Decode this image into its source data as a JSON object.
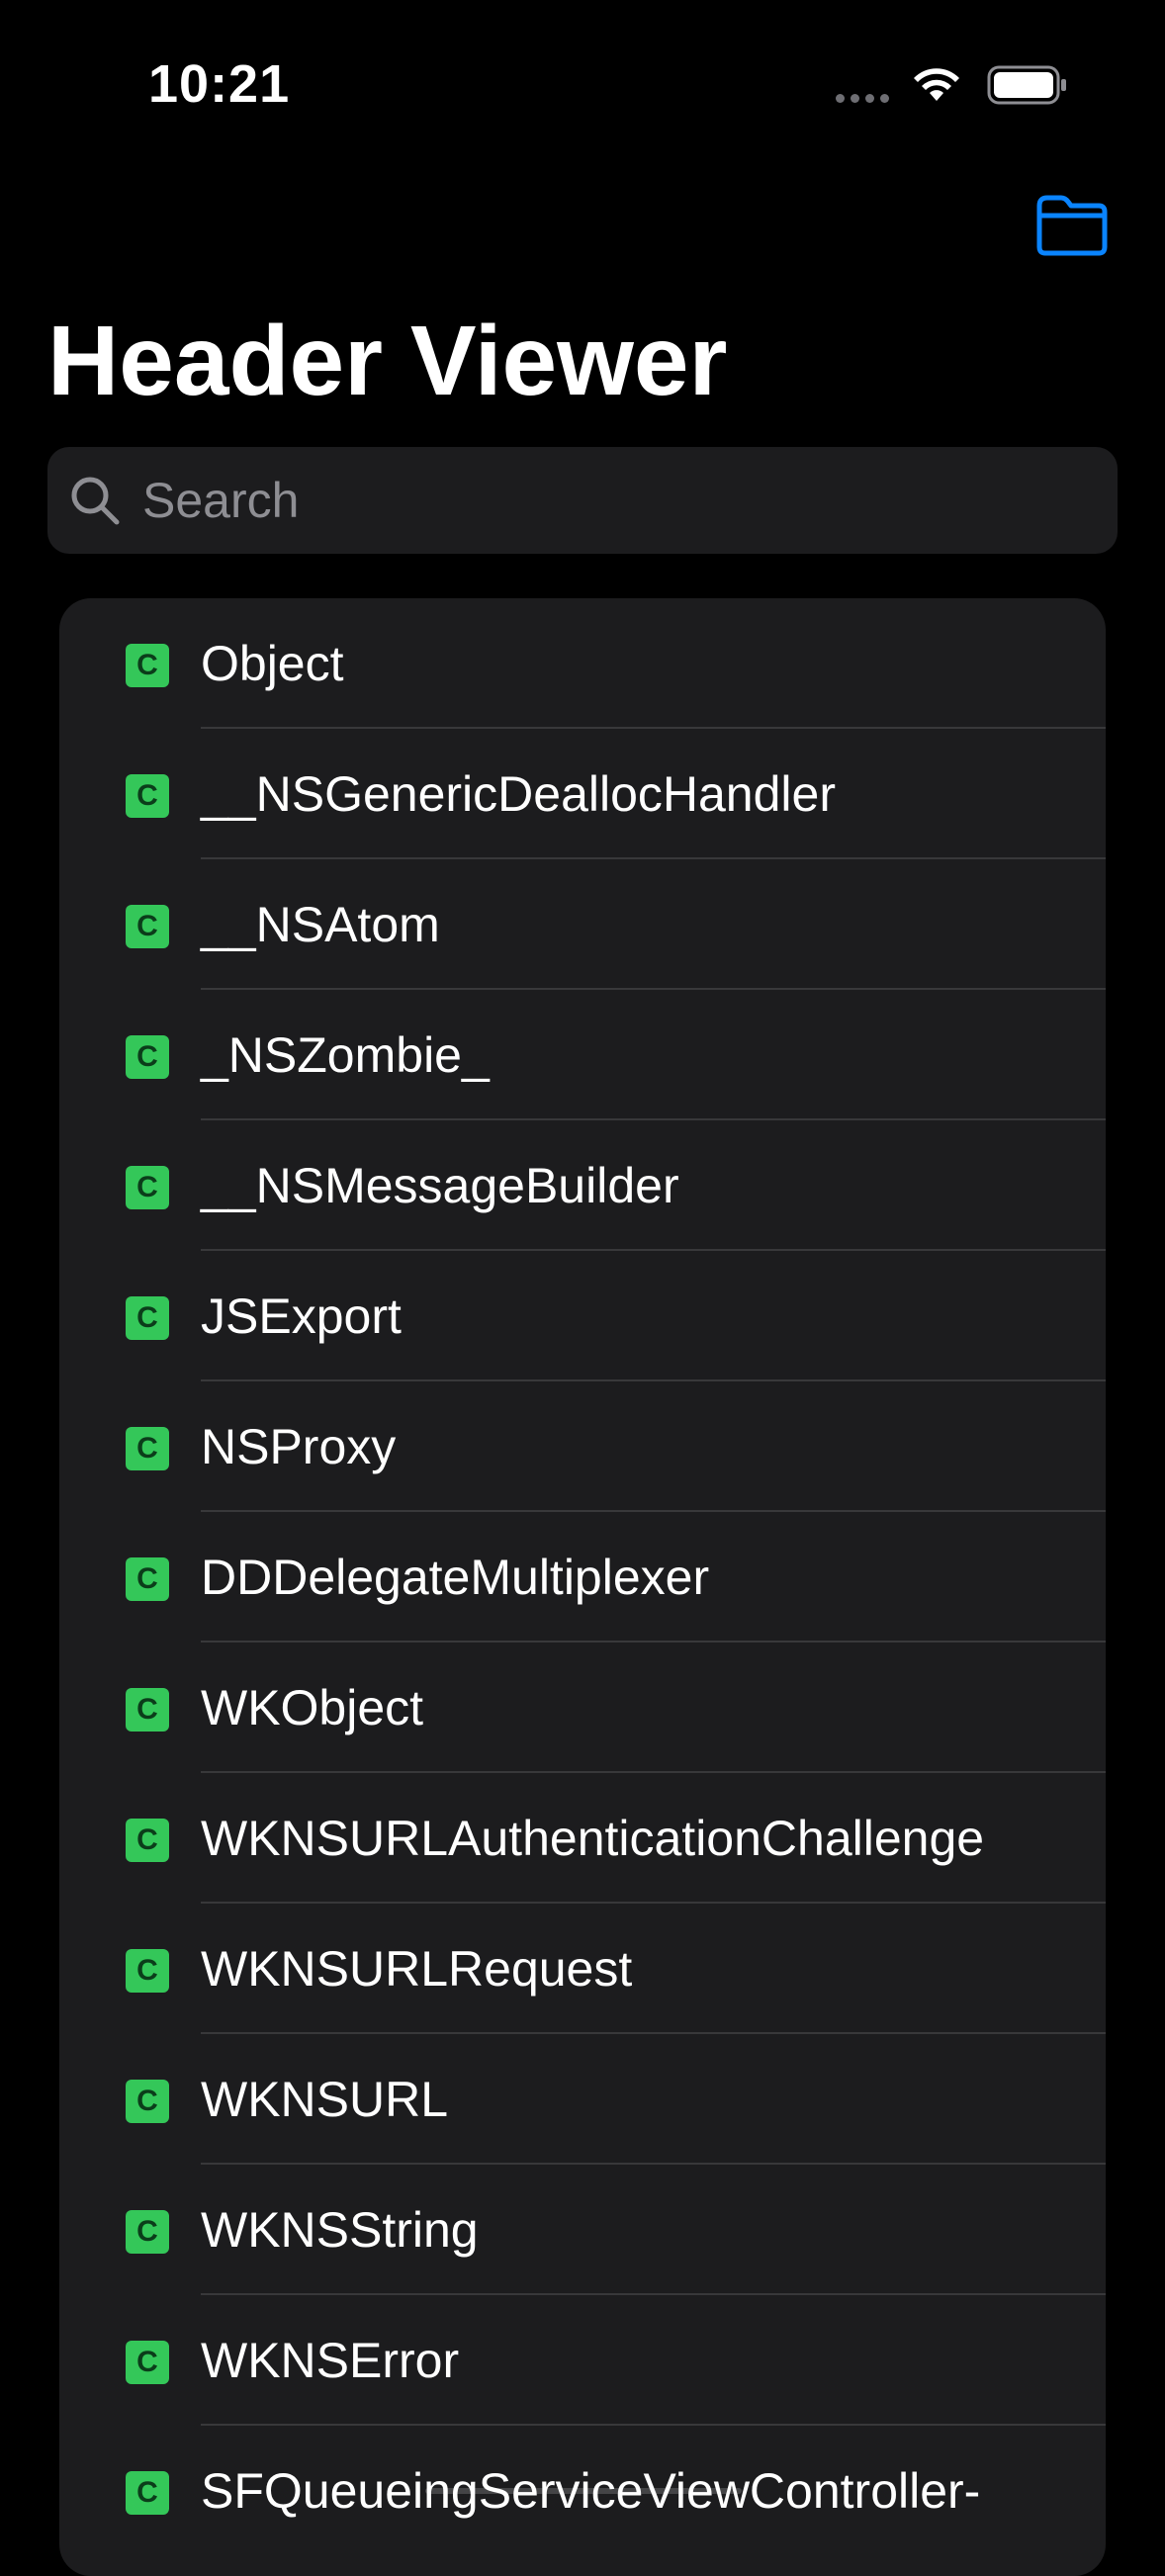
{
  "status_bar": {
    "time": "10:21"
  },
  "nav": {
    "title": "Header Viewer",
    "folder_icon": "folder-icon"
  },
  "search": {
    "placeholder": "Search"
  },
  "list": {
    "badge": "C",
    "items": [
      "Object",
      "__NSGenericDeallocHandler",
      "__NSAtom",
      "_NSZombie_",
      "__NSMessageBuilder",
      "JSExport",
      "NSProxy",
      "DDDelegateMultiplexer",
      "WKObject",
      "WKNSURLAuthenticationChallenge",
      "WKNSURLRequest",
      "WKNSURL",
      "WKNSString",
      "WKNSError",
      "SFQueueingServiceViewController-"
    ]
  },
  "colors": {
    "accent": "#0a84ff",
    "badge": "#34c759",
    "background": "#000000",
    "card": "#1c1c1e"
  }
}
